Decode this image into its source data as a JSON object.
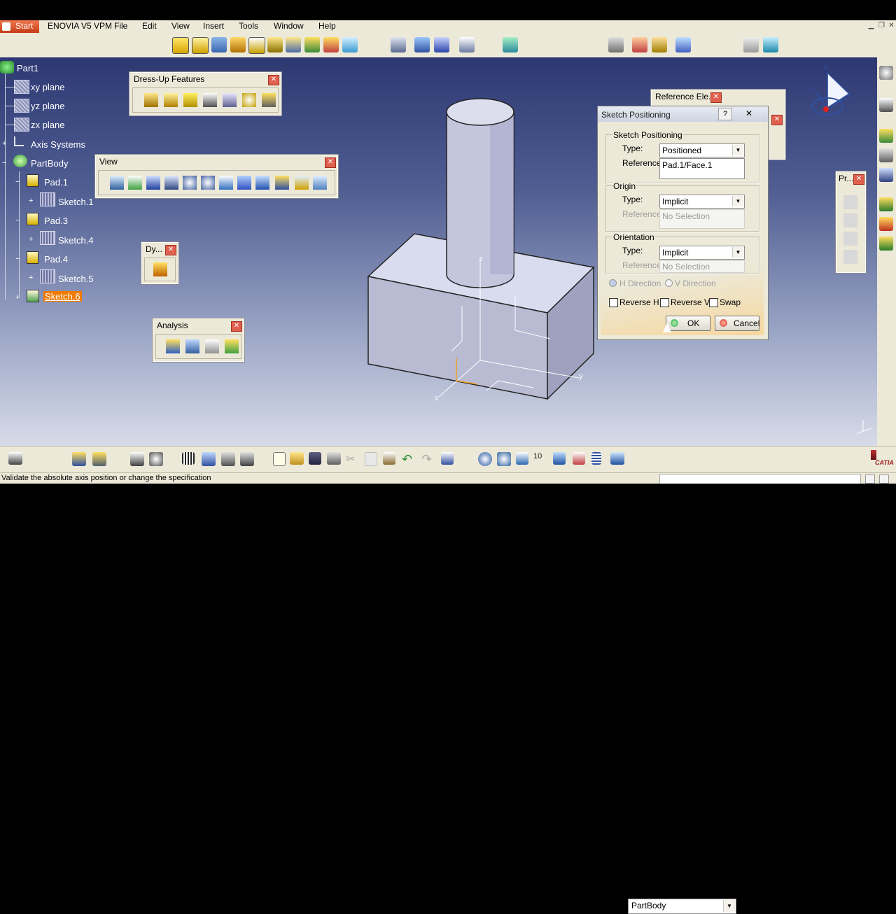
{
  "menubar": {
    "start": "Start",
    "items": [
      "ENOVIA V5 VPM",
      "File",
      "Edit",
      "View",
      "Insert",
      "Tools",
      "Window",
      "Help"
    ]
  },
  "tree": {
    "root": "Part1",
    "items": [
      "xy plane",
      "yz plane",
      "zx plane",
      "Axis Systems",
      "PartBody",
      "Pad.1",
      "Sketch.1",
      "Pad.3",
      "Sketch.4",
      "Pad.4",
      "Sketch.5",
      "Sketch.6"
    ],
    "selected_color": "#f07a00"
  },
  "toolbars": {
    "dressup": "Dress-Up Features",
    "view": "View",
    "dynamic": "Dy...",
    "analysis": "Analysis",
    "reference": "Reference Ele...",
    "pr": "Pr..."
  },
  "dialog": {
    "title": "Sketch Positioning",
    "group_positioning": "Sketch Positioning",
    "type_label": "Type:",
    "type_value": "Positioned",
    "reference_label": "Reference:",
    "reference_value": "Pad.1/Face.1",
    "group_origin": "Origin",
    "origin_type_label": "Type:",
    "origin_type_value": "Implicit",
    "origin_reference_label": "Reference:",
    "origin_reference_value": "No Selection",
    "group_orientation": "Orientation",
    "orient_type_label": "Type:",
    "orient_type_value": "Implicit",
    "orient_reference_label": "Reference:",
    "orient_reference_value": "No Selection",
    "h_direction": "H Direction",
    "v_direction": "V Direction",
    "reverse_h": "Reverse H",
    "reverse_v": "Reverse V",
    "swap": "Swap",
    "ok": "OK",
    "cancel": "Cancel",
    "help_glyph": "?"
  },
  "axis_labels": {
    "x": "x",
    "y": "y",
    "z": "z"
  },
  "compass_labels": {
    "z": "z",
    "x": "x",
    "y": "y"
  },
  "bottom": {
    "partbody": "PartBody",
    "logo": "CATIA"
  },
  "status": "Validate the absolute axis position or change the specification",
  "colors": {
    "viewport_top": "#2d3872",
    "viewport_bottom": "#d8dbe8",
    "ui_face": "#ece9d8",
    "ok_dot": "#2aa84a",
    "cancel_dot": "#d83c2c"
  }
}
